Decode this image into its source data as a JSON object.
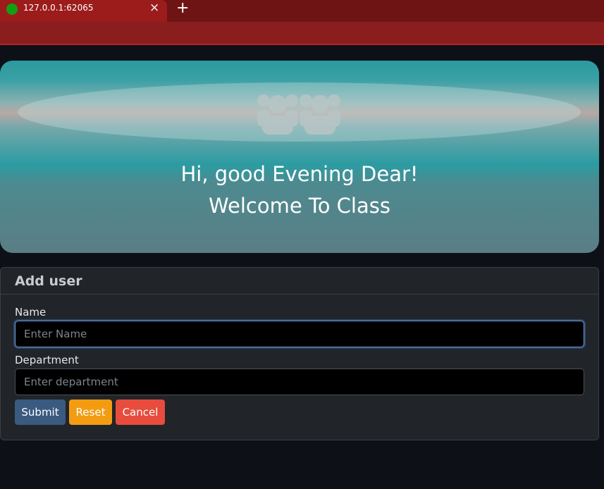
{
  "browser": {
    "tab_title": "127.0.0.1:62065",
    "close_glyph": "×",
    "new_tab_glyph": "+",
    "favicon_color": "#12a012"
  },
  "hero": {
    "icon": "users-group-icon",
    "greeting": "Hi, good Evening Dear!",
    "welcome": "Welcome To Class"
  },
  "form": {
    "title": "Add user",
    "name_label": "Name",
    "name_placeholder": "Enter Name",
    "name_value": "",
    "department_label": "Department",
    "department_placeholder": "Enter department",
    "department_value": "",
    "submit_label": "Submit",
    "reset_label": "Reset",
    "cancel_label": "Cancel"
  },
  "colors": {
    "page_bg": "#0d1117",
    "card_bg": "#212529",
    "submit": "#3a5a80",
    "reset": "#f39c12",
    "cancel": "#e74c3c",
    "tab_bar": "#6e1414"
  }
}
